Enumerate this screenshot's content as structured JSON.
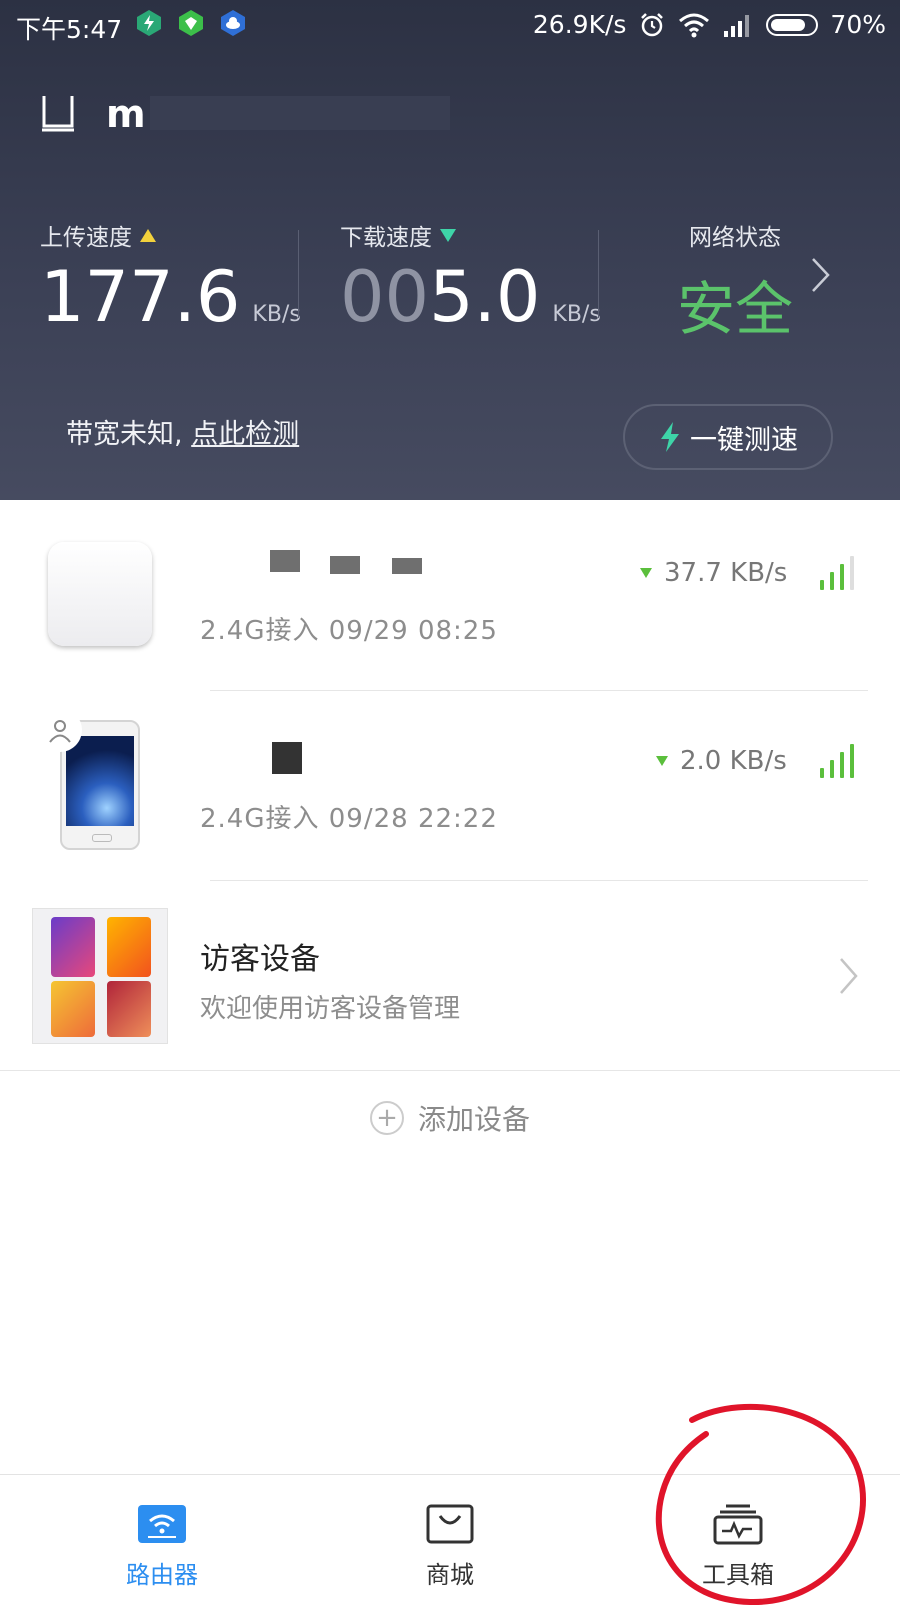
{
  "status_bar": {
    "time": "下午5:47",
    "net_speed": "26.9K/s",
    "battery": "70%"
  },
  "router": {
    "name": "mi"
  },
  "stats": {
    "upload": {
      "label": "上传速度",
      "value": "177.6",
      "unit": "KB/s"
    },
    "download": {
      "label": "下载速度",
      "value_dim": "00",
      "value": "5.0",
      "unit": "KB/s"
    },
    "network": {
      "label": "网络状态",
      "value": "安全"
    }
  },
  "bandwidth": {
    "text": "带宽未知,",
    "link": "点此检测",
    "speedtest_button": "一键测速"
  },
  "devices": [
    {
      "subtitle": "2.4G接入   09/29 08:25",
      "speed": "37.7 KB/s",
      "signal_level": 3
    },
    {
      "subtitle": "2.4G接入   09/28 22:22",
      "speed": "2.0 KB/s",
      "signal_level": 4
    }
  ],
  "guest": {
    "title": "访客设备",
    "subtitle": "欢迎使用访客设备管理"
  },
  "add_device": "添加设备",
  "nav": {
    "router": "路由器",
    "store": "商城",
    "toolbox": "工具箱"
  },
  "colors": {
    "header_bg": "#363b4f",
    "accent_blue": "#2c8ef0",
    "safe_green": "#5bc36b",
    "signal_green": "#5bbf3c",
    "annotation_red": "#e0142a"
  }
}
